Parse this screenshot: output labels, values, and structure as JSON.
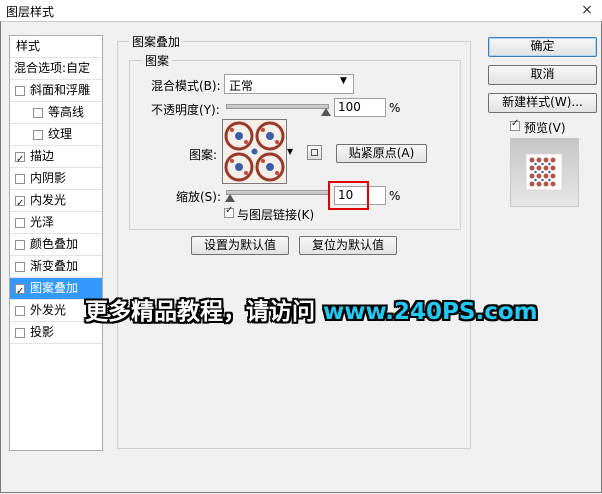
{
  "window": {
    "title": "图层样式",
    "close_glyph": "×"
  },
  "sidebar": {
    "header": "样式",
    "blend_options": "混合选项:自定",
    "items": [
      {
        "label": "斜面和浮雕",
        "checked": false
      },
      {
        "label": "等高线",
        "checked": false
      },
      {
        "label": "纹理",
        "checked": false
      },
      {
        "label": "描边",
        "checked": true
      },
      {
        "label": "内阴影",
        "checked": false
      },
      {
        "label": "内发光",
        "checked": true
      },
      {
        "label": "光泽",
        "checked": false
      },
      {
        "label": "颜色叠加",
        "checked": false
      },
      {
        "label": "渐变叠加",
        "checked": false
      },
      {
        "label": "图案叠加",
        "checked": true,
        "selected": true
      },
      {
        "label": "外发光",
        "checked": false
      },
      {
        "label": "投影",
        "checked": false
      }
    ]
  },
  "panel": {
    "section_title": "图案叠加",
    "group_title": "图案",
    "blend_mode_label": "混合模式(B):",
    "blend_mode_value": "正常",
    "opacity_label": "不透明度(Y):",
    "opacity_value": "100",
    "opacity_unit": "%",
    "opacity_level": 1.0,
    "pattern_label": "图案:",
    "snap_origin_label": "贴紧原点(A)",
    "scale_label": "缩放(S):",
    "scale_value": "10",
    "scale_unit": "%",
    "scale_level": 0.01,
    "link_label": "与图层链接(K)",
    "link_checked": true,
    "set_default_label": "设置为默认值",
    "reset_default_label": "复位为默认值"
  },
  "right": {
    "ok_label": "确定",
    "cancel_label": "取消",
    "new_style_label": "新建样式(W)...",
    "preview_label": "预览(V)",
    "preview_checked": true
  },
  "watermark": {
    "text": "更多精品教程，请访问 ",
    "url": "www.240PS.com"
  },
  "colors": {
    "accent_selected": "#3399ff",
    "highlight_box": "#e00000",
    "watermark_text": "#ffffff",
    "watermark_url": "#22c8f0"
  }
}
